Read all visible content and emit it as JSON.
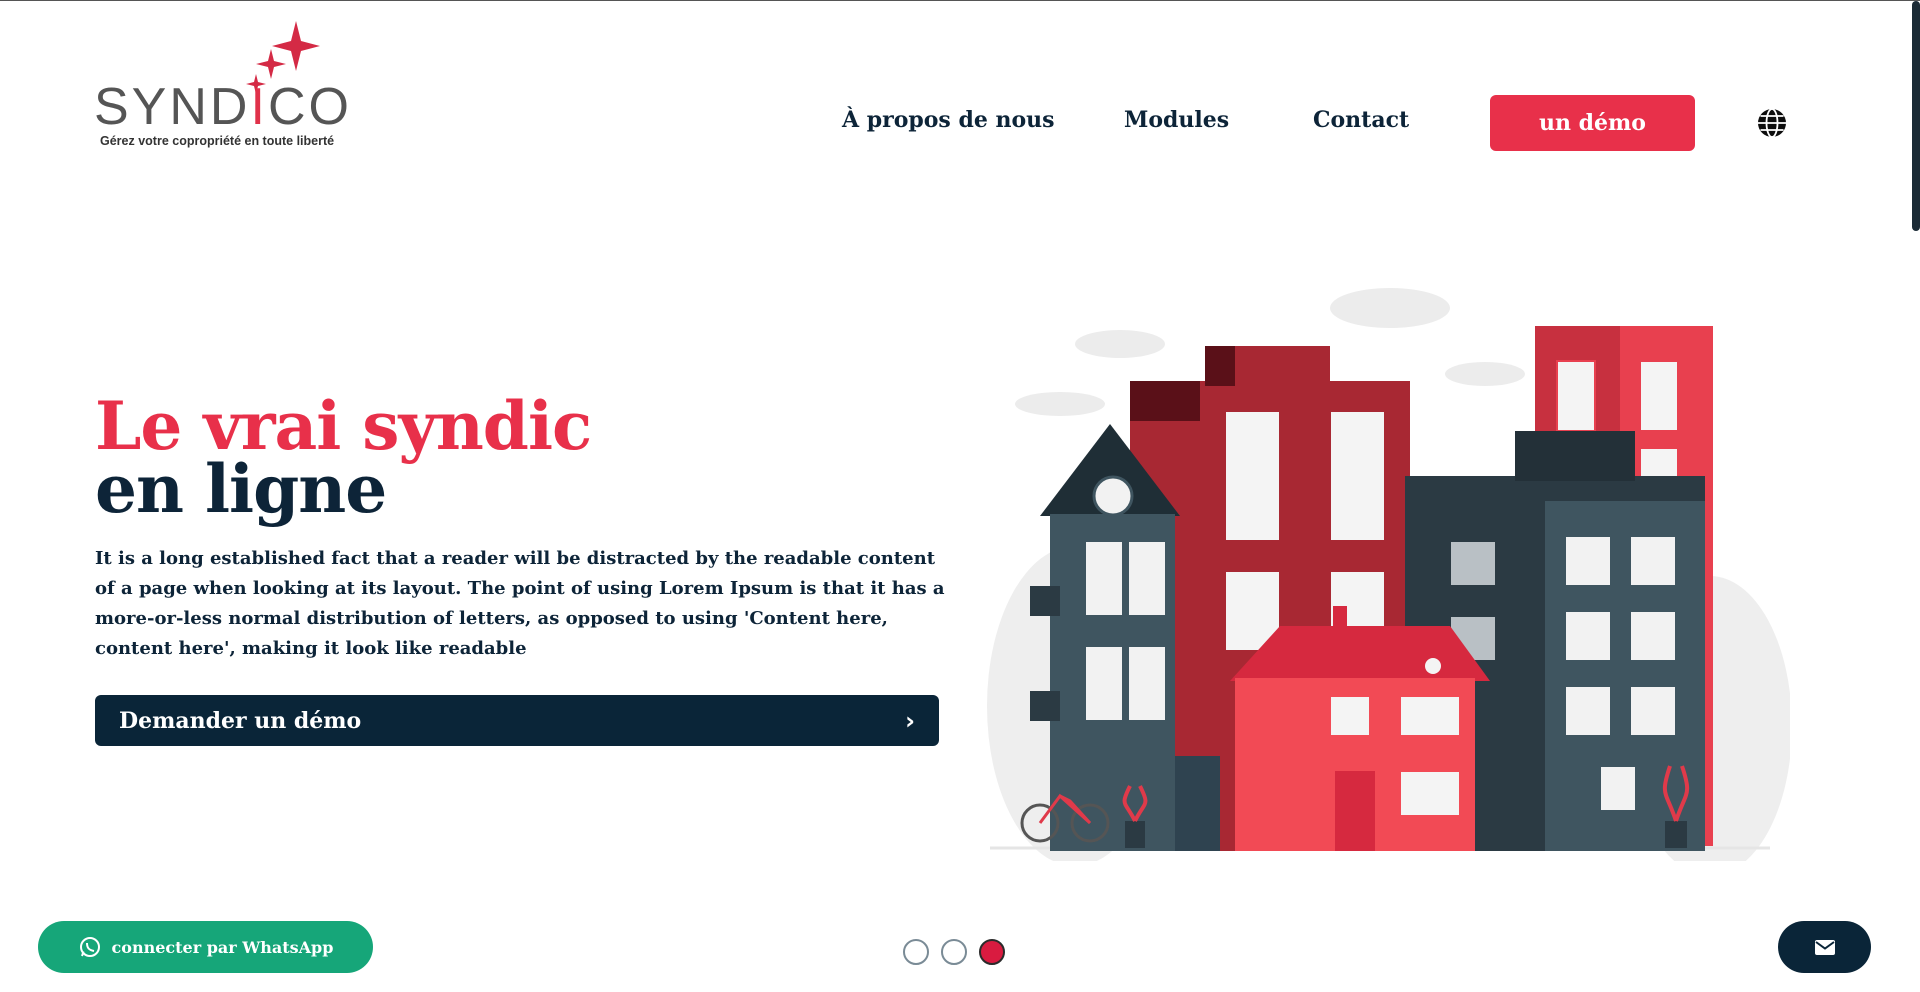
{
  "brand": {
    "name_prefix": "SYND",
    "name_accent": "I",
    "name_suffix": "CO",
    "tagline": "Gérez votre copropriété en toute liberté"
  },
  "nav": {
    "about": "À propos de nous",
    "modules": "Modules",
    "contact": "Contact",
    "demo_button": "un démo",
    "language_icon": "globe-icon"
  },
  "hero": {
    "title_line1": "Le vrai syndic",
    "title_line2": "en ligne",
    "description": "It is a long established fact that a reader will be distracted by the readable content of a page when looking at its layout. The point of using Lorem Ipsum is that it has a more-or-less normal distribution of letters, as opposed to using 'Content here, content here', making it look like readable",
    "cta_label": "Demander un démo",
    "cta_icon": "chevron-right-icon"
  },
  "carousel": {
    "slides": 3,
    "active_index": 3
  },
  "footer_actions": {
    "whatsapp_label": "connecter par WhatsApp",
    "whatsapp_icon": "whatsapp-icon",
    "mail_icon": "envelope-icon"
  },
  "colors": {
    "primary_red": "#e8304a",
    "navy": "#0a2538",
    "whatsapp_green": "#16a679"
  }
}
